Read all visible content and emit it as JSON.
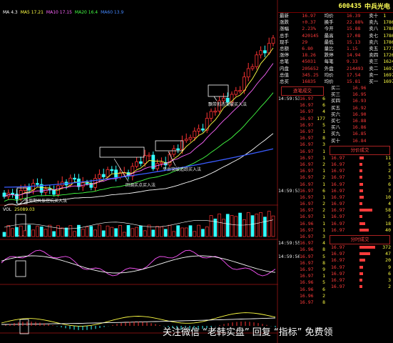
{
  "header": {
    "code": "600435",
    "name": "中兵光电"
  },
  "top_legend": [
    {
      "text": "MA 4.3",
      "color": "#ffffff"
    },
    {
      "text": "MA5 17.21",
      "color": "#ffff44"
    },
    {
      "text": "MA10 17.15",
      "color": "#ff66ff"
    },
    {
      "text": "MA20 16.4",
      "color": "#44ff44"
    },
    {
      "text": "MA60 13.9",
      "color": "#4488ff"
    }
  ],
  "annotations": {
    "a1": "多周期共振挖坑买入法",
    "a2": "回调买点买入法",
    "a3": "平台突破追踪买入法",
    "a4": "飘带形态突破买入法"
  },
  "volume_legend": [
    {
      "text": "VOL",
      "color": "#ffffff"
    },
    {
      "text": "25089.03",
      "color": "#ffff44"
    }
  ],
  "watermark": "关注微信 “老韩实盘” 回复 “指标” 免费领",
  "quote_rows": [
    {
      "a": "最新",
      "b": "16.97",
      "c": "均价",
      "d": "16.39",
      "e": "卖十",
      "f": "1"
    },
    {
      "a": "涨跌",
      "b": "↑0.37",
      "c": "换手",
      "d": "22.88%",
      "e": "卖九",
      "f": "1786"
    },
    {
      "a": "涨幅",
      "b": "2.23%",
      "c": "今开",
      "d": "15.88",
      "e": "卖八",
      "f": "1788"
    },
    {
      "a": "总手",
      "b": "420145",
      "c": "最高",
      "d": "17.08",
      "e": "卖七",
      "f": "1786"
    },
    {
      "a": "现手",
      "b": "29",
      "c": "最低",
      "d": "15.13",
      "e": "卖六",
      "f": "1786"
    },
    {
      "a": "总额",
      "b": "6.80",
      "c": "量比",
      "d": "1.15",
      "e": "卖五",
      "f": "1771"
    },
    {
      "a": "涨停",
      "b": "18.26",
      "c": "跌停",
      "d": "14.94",
      "e": "卖四",
      "f": "1726"
    },
    {
      "a": "总笔",
      "b": "45031",
      "c": "每笔",
      "d": "9.33",
      "e": "卖三",
      "f": "1624"
    },
    {
      "a": "内盘",
      "b": "205652",
      "c": "外盘",
      "d": "214493",
      "e": "卖二",
      "f": "1697"
    },
    {
      "a": "总值",
      "b": "345.25",
      "c": "均价",
      "d": "17.54",
      "e": "卖一",
      "f": "1697"
    },
    {
      "a": "总买",
      "b": "16835",
      "c": "均价",
      "d": "15.81",
      "e": "买一",
      "f": "1697"
    }
  ],
  "trade_title": "逐笔成交",
  "ticks_left": [
    {
      "t": "14:59:53",
      "p": "16.97",
      "v": "6"
    },
    {
      "t": "",
      "p": "16.97",
      "v": "6"
    },
    {
      "t": "",
      "p": "16.97",
      "v": "4"
    },
    {
      "t": "",
      "p": "16.97",
      "v": "177"
    },
    {
      "t": "",
      "p": "16.97",
      "v": "5"
    },
    {
      "t": "",
      "p": "16.97",
      "v": "1"
    },
    {
      "t": "",
      "p": "16.97",
      "v": "8"
    },
    {
      "t": "",
      "p": "16.97",
      "v": "3"
    },
    {
      "t": "",
      "p": "16.97",
      "v": "1"
    },
    {
      "t": "",
      "p": "16.97",
      "v": "1"
    },
    {
      "t": "",
      "p": "16.97",
      "v": "2"
    },
    {
      "t": "",
      "p": "16.97",
      "v": "1"
    },
    {
      "t": "",
      "p": "16.97",
      "v": "2"
    },
    {
      "t": "",
      "p": "16.97",
      "v": "1"
    },
    {
      "t": "14:59:53",
      "p": "16.97",
      "v": "6"
    },
    {
      "t": "",
      "p": "16.97",
      "v": "1"
    },
    {
      "t": "",
      "p": "16.97",
      "v": "2"
    },
    {
      "t": "",
      "p": "16.97",
      "v": "2"
    },
    {
      "t": "",
      "p": "16.97",
      "v": "1"
    },
    {
      "t": "",
      "p": "16.96",
      "v": "1"
    },
    {
      "t": "",
      "p": "16.97",
      "v": "1"
    },
    {
      "t": "",
      "p": "16.97",
      "v": "3"
    },
    {
      "t": "14:59:55",
      "p": "16.97",
      "v": "4"
    },
    {
      "t": "",
      "p": "16.96",
      "v": "8"
    },
    {
      "t": "14:59:56",
      "p": "16.97",
      "v": "5"
    },
    {
      "t": "",
      "p": "16.97",
      "v": "8"
    },
    {
      "t": "",
      "p": "16.97",
      "v": "9"
    },
    {
      "t": "",
      "p": "16.97",
      "v": "1"
    },
    {
      "t": "",
      "p": "16.96",
      "v": "5"
    },
    {
      "t": "",
      "p": "16.96",
      "v": "6"
    },
    {
      "t": "",
      "p": "16.96",
      "v": "2"
    },
    {
      "t": "",
      "p": "16.97",
      "v": "8"
    }
  ],
  "ticks_right_top": [
    {
      "a": "买二",
      "b": "16.96"
    },
    {
      "a": "买三",
      "b": "16.95"
    },
    {
      "a": "买四",
      "b": "16.93"
    },
    {
      "a": "买五",
      "b": "16.92"
    },
    {
      "a": "买六",
      "b": "16.90"
    },
    {
      "a": "买七",
      "b": "16.88"
    },
    {
      "a": "买八",
      "b": "16.86"
    },
    {
      "a": "买九",
      "b": "16.85"
    },
    {
      "a": "买十",
      "b": "16.84"
    }
  ],
  "fenjia_title": "分价成交",
  "fenjia_title2": "分时成交",
  "fenjia_rows": [
    {
      "p": "16.97",
      "v": "11"
    },
    {
      "p": "16.97",
      "v": "5"
    },
    {
      "p": "16.97",
      "v": "2"
    },
    {
      "p": "16.97",
      "v": "3"
    },
    {
      "p": "16.97",
      "v": "6"
    },
    {
      "p": "16.97",
      "v": "7"
    },
    {
      "p": "16.97",
      "v": "10"
    },
    {
      "p": "16.97",
      "v": "4"
    },
    {
      "p": "16.97",
      "v": "58"
    },
    {
      "p": "16.97",
      "v": "5"
    },
    {
      "p": "16.97",
      "v": "18"
    },
    {
      "p": "16.97",
      "v": "40"
    }
  ],
  "fenshi_rows": [
    {
      "p": "16.97",
      "v": "372"
    },
    {
      "p": "16.97",
      "v": "47"
    },
    {
      "p": "16.97",
      "v": "20"
    },
    {
      "p": "16.97",
      "v": "9"
    },
    {
      "p": "16.97",
      "v": "6"
    },
    {
      "p": "16.97",
      "v": "3"
    },
    {
      "p": "16.97",
      "v": "2"
    }
  ]
}
